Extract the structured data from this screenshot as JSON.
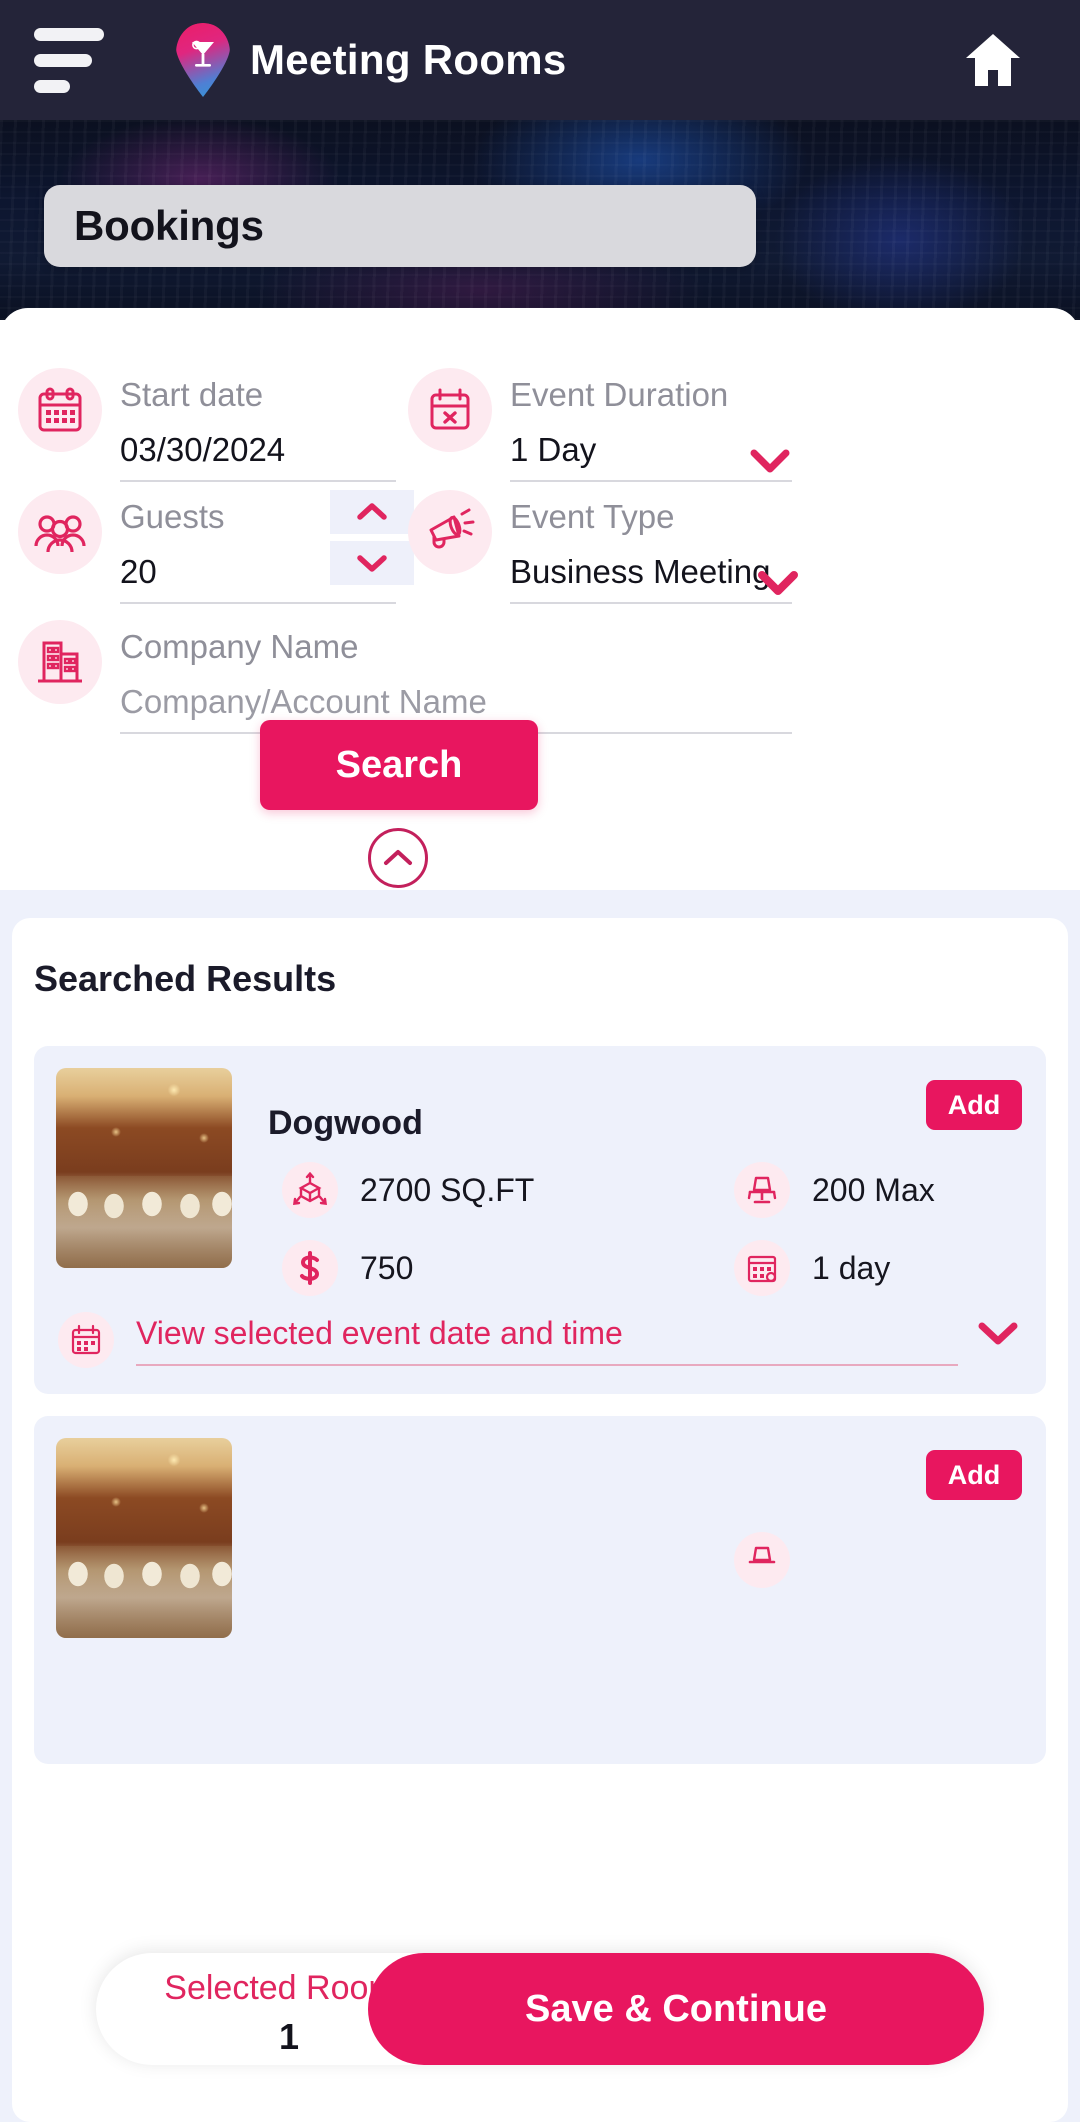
{
  "header": {
    "title": "Meeting Rooms",
    "menu_icon": "hamburger-icon",
    "logo_icon": "location-pin-cocktail-icon",
    "home_icon": "home-icon"
  },
  "hero": {
    "search_value": "Bookings"
  },
  "form": {
    "start_date": {
      "label": "Start date",
      "value": "03/30/2024",
      "icon": "calendar-icon"
    },
    "event_duration": {
      "label": "Event Duration",
      "value": "1 Day",
      "icon": "calendar-x-icon",
      "chevron": "chevron-down-icon"
    },
    "guests": {
      "label": "Guests",
      "value": "20",
      "icon": "people-group-icon",
      "increment_icon": "chevron-up-icon",
      "decrement_icon": "chevron-down-icon"
    },
    "event_type": {
      "label": "Event Type",
      "value": "Business Meeting",
      "icon": "megaphone-icon",
      "chevron": "chevron-down-icon"
    },
    "company_name": {
      "label": "Company Name",
      "placeholder": "Company/Account Name",
      "icon": "building-icon"
    },
    "search_label": "Search",
    "collapse_icon": "chevron-up-circle-icon"
  },
  "results": {
    "title": "Searched Results",
    "rooms": [
      {
        "name": "Dogwood",
        "add_label": "Add",
        "area": "2700 SQ.FT",
        "capacity": "200 Max",
        "price": "750",
        "duration": "1 day",
        "view_label": "View selected event date and time",
        "area_icon": "area-cube-icon",
        "capacity_icon": "chair-icon",
        "price_icon": "dollar-icon",
        "duration_icon": "calendar-grid-icon",
        "view_icon": "calendar-icon",
        "view_chevron": "chevron-down-icon",
        "thumb_icon": "banquet-hall-photo"
      },
      {
        "name": "",
        "add_label": "Add",
        "area": "",
        "capacity": "",
        "price": "",
        "duration": "",
        "view_label": "",
        "area_icon": "area-cube-icon",
        "capacity_icon": "chair-icon",
        "price_icon": "dollar-icon",
        "duration_icon": "calendar-grid-icon",
        "view_icon": "calendar-icon",
        "view_chevron": "chevron-down-icon",
        "thumb_icon": "banquet-hall-photo"
      }
    ]
  },
  "bottom_bar": {
    "selected_rooms_label": "Selected Rooms",
    "selected_rooms_count": "1",
    "save_label": "Save & Continue"
  },
  "colors": {
    "accent": "#e8165f",
    "accent_dark": "#c3205c",
    "header_bg": "#242439",
    "icon_bg": "#fdeaf0",
    "results_bg": "#eef1fb"
  }
}
